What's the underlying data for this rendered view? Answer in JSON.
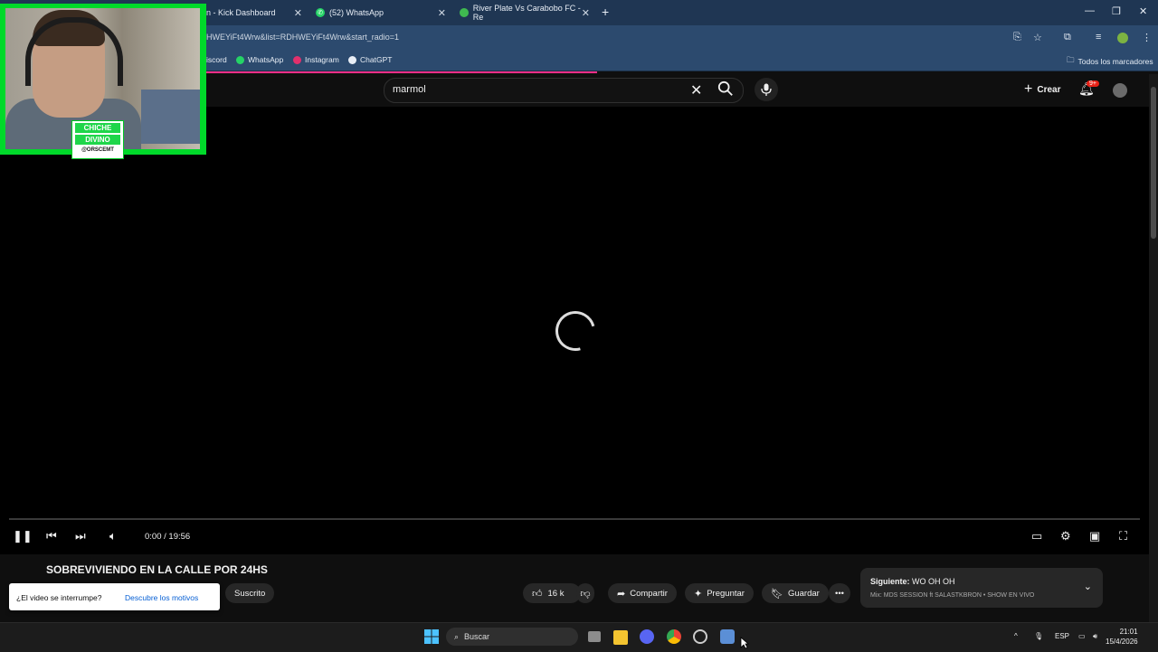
{
  "browser": {
    "tabs": [
      {
        "title": "n - Kick Dashboard",
        "favicon": "kick-icon"
      },
      {
        "title": "(52) WhatsApp",
        "favicon": "whatsapp-icon"
      },
      {
        "title": "River Plate Vs Carabobo FC - Re",
        "favicon": "river-plate-icon"
      }
    ],
    "new_tab": "+",
    "url": "HWEYiFt4Wrw&list=RDHWEYiFt4Wrw&start_radio=1",
    "bookmarks": [
      {
        "label": "iscord"
      },
      {
        "label": "WhatsApp"
      },
      {
        "label": "Instagram"
      },
      {
        "label": "ChatGPT"
      }
    ],
    "all_bookmarks": "Todos los marcadores"
  },
  "youtube": {
    "search_value": "marmol",
    "create_label": "Crear",
    "notifications_badge": "9+"
  },
  "player": {
    "time": "0:00 / 19:56"
  },
  "video": {
    "title": "SOBREVIVIENDO EN LA CALLE POR 24HS",
    "subscribed_label": "Suscrito",
    "likes": "16 k",
    "share_label": "Compartir",
    "ask_label": "Preguntar",
    "save_label": "Guardar"
  },
  "toast": {
    "question": "¿El video se interrumpe?",
    "action": "Descubre los motivos"
  },
  "next_up": {
    "prefix": "Siguiente:",
    "title": "WO OH OH",
    "subtitle": "Mix: MDS SESSION ft SALASTKBRON • SHOW EN VIVO"
  },
  "webcam": {
    "logo_line1": "CHICHE",
    "logo_line2": "DIVINO",
    "logo_line3": "@ORSCEMT"
  },
  "taskbar": {
    "search_placeholder": "Buscar",
    "language": "ESP",
    "time": "21:01",
    "date": "15/4/2026"
  },
  "colors": {
    "accent_progress": "#ff2e88",
    "webcam_border": "#00d92a",
    "chrome_tabs": "#1f3653",
    "chrome_toolbar": "#2c4a6e"
  }
}
